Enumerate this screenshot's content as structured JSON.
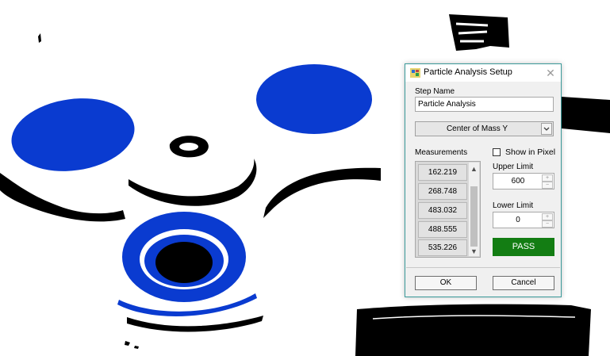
{
  "dialog": {
    "title": "Particle Analysis Setup",
    "close_glyph": "✕",
    "step_name_label": "Step Name",
    "step_name_value": "Particle Analysis",
    "measurement_type": "Center of Mass Y",
    "measurements_label": "Measurements",
    "measurements": [
      "162.219",
      "268.748",
      "483.032",
      "488.555",
      "535.226"
    ],
    "show_in_pixel_label": "Show in Pixel",
    "show_in_pixel_checked": false,
    "upper_limit_label": "Upper Limit",
    "upper_limit_value": "600",
    "lower_limit_label": "Lower Limit",
    "lower_limit_value": "0",
    "result_label": "PASS",
    "result_color": "#137d13",
    "ok_label": "OK",
    "cancel_label": "Cancel"
  },
  "icons": {
    "app": "app-icon",
    "close": "close-icon",
    "dropdown": "chevron-down-icon",
    "scroll_up": "scroll-up-arrow-icon",
    "scroll_down": "scroll-down-arrow-icon",
    "spin_up": "spin-up-icon",
    "spin_down": "spin-down-icon"
  },
  "scene": {
    "description_colors": {
      "blob": "#0a3bd0",
      "ink": "#000000"
    }
  }
}
